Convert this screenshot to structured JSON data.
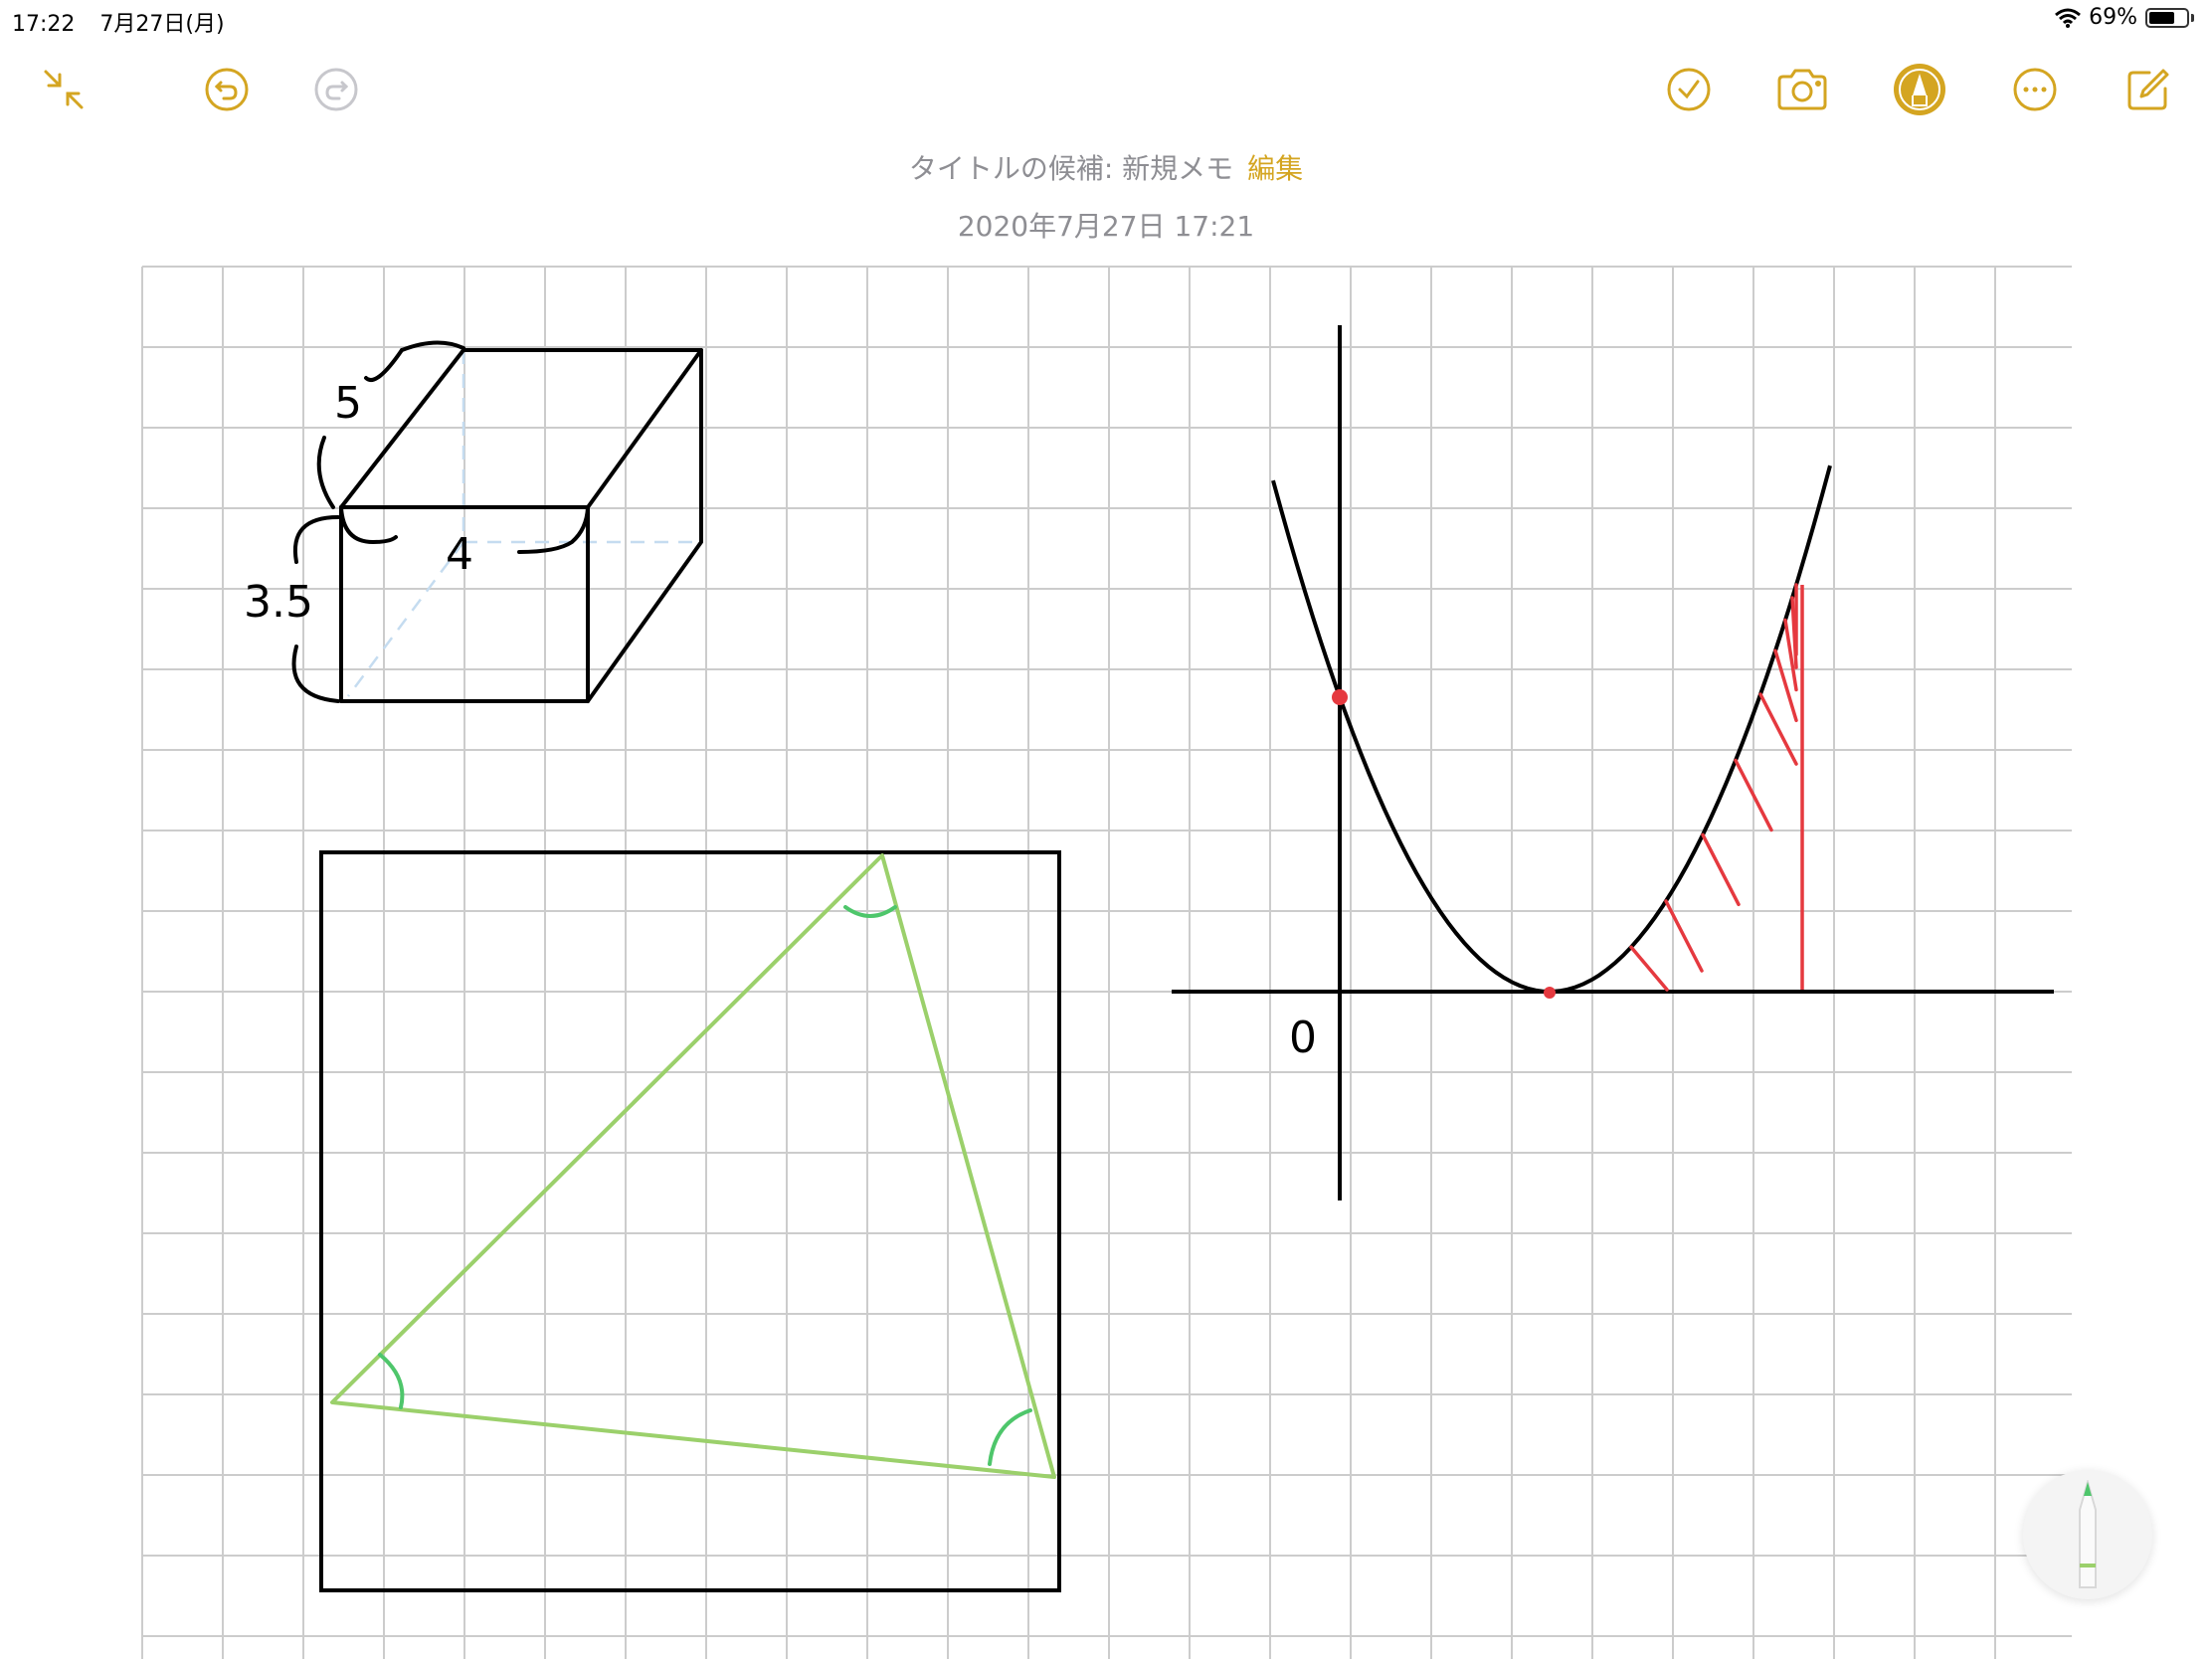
{
  "status_bar": {
    "time": "17:22",
    "date": "7月27日(月)",
    "battery_percent": "69%",
    "battery_level": 0.69
  },
  "toolbar": {
    "left": [
      "collapse-icon",
      "undo-icon",
      "redo-icon"
    ],
    "right": [
      "checklist-icon",
      "camera-icon",
      "markup-pen-icon",
      "more-icon",
      "compose-icon"
    ],
    "accent": "#d4a521"
  },
  "note": {
    "title_prefix": "タイトルの候補: 新規メモ",
    "edit_label": "編集",
    "timestamp": "2020年7月27日 17:21"
  },
  "drawing": {
    "box_labels": {
      "depth": "5",
      "width": "4",
      "height": "3.5"
    },
    "graph_origin_label": "0",
    "colors": {
      "ink": "#000000",
      "highlight": "#e5393f",
      "triangle": "#9bd06b",
      "angle_marks": "#4ec66b",
      "hidden_edges": "#c5dcf0",
      "grid": "#cccccc"
    }
  },
  "tool_button": {
    "name": "pencil-tool"
  }
}
